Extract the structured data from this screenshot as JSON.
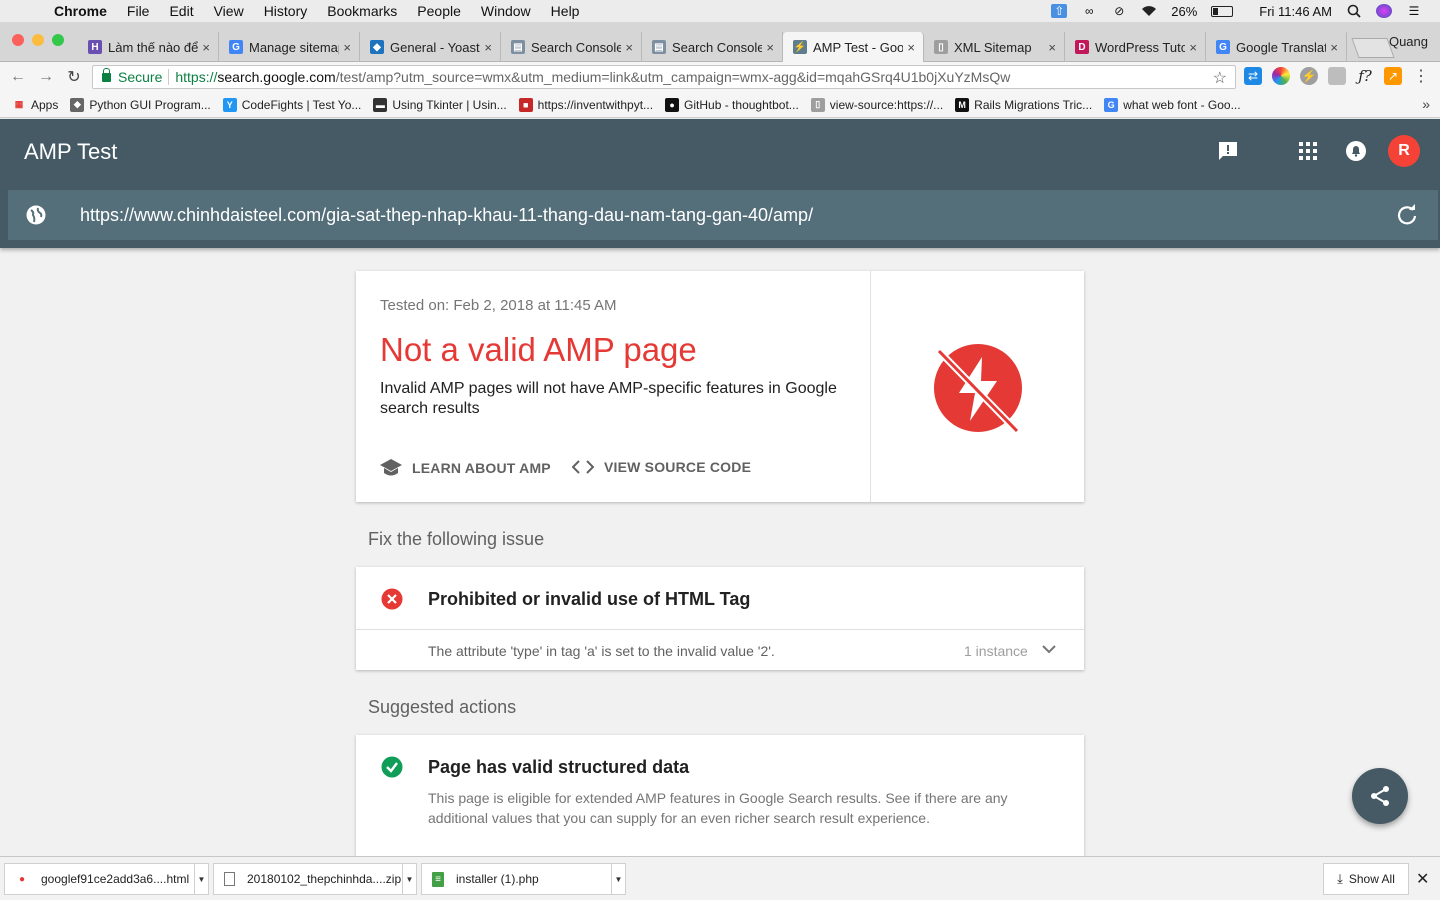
{
  "menubar": {
    "app": "Chrome",
    "items": [
      "File",
      "Edit",
      "View",
      "History",
      "Bookmarks",
      "People",
      "Window",
      "Help"
    ],
    "battery": "26%",
    "clock": "Fri 11:46 AM"
  },
  "tabs": [
    {
      "title": "Làm thế nào để",
      "fav_color": "#6a4fb3",
      "fav": "H"
    },
    {
      "title": "Manage sitemap",
      "fav_color": "#4285f4",
      "fav": "G"
    },
    {
      "title": "General - Yoast",
      "fav_color": "#1e73be",
      "fav": "◆"
    },
    {
      "title": "Search Console",
      "fav_color": "#7d8fa0",
      "fav": "▤"
    },
    {
      "title": "Search Console",
      "fav_color": "#7d8fa0",
      "fav": "▤"
    },
    {
      "title": "AMP Test - Goo",
      "fav_color": "#5f7d8c",
      "fav": "⚡"
    },
    {
      "title": "XML Sitemap",
      "fav_color": "#9e9e9e",
      "fav": "▯"
    },
    {
      "title": "WordPress Tuto",
      "fav_color": "#c2185b",
      "fav": "D"
    },
    {
      "title": "Google Translat",
      "fav_color": "#4285f4",
      "fav": "G"
    }
  ],
  "profile_name": "Quang",
  "omnibox": {
    "secure_label": "Secure",
    "url_scheme": "https://",
    "url_host": "search.google.com",
    "url_rest": "/test/amp?utm_source=wmx&utm_medium=link&utm_campaign=wmx-agg&id=mqahGSrq4U1b0jXuYzMsQw"
  },
  "bookmarks": [
    {
      "label": "Apps",
      "color": "#e53935",
      "icon": "▦"
    },
    {
      "label": "Python GUI Program...",
      "color": "#666666",
      "icon": "◆"
    },
    {
      "label": "CodeFights | Test Yo...",
      "color": "#2196f3",
      "icon": "Y"
    },
    {
      "label": "Using Tkinter | Usin...",
      "color": "#333333",
      "icon": "▬"
    },
    {
      "label": "https://inventwithpyt...",
      "color": "#c62828",
      "icon": "■"
    },
    {
      "label": "GitHub - thoughtbot...",
      "color": "#111111",
      "icon": "●"
    },
    {
      "label": "view-source:https://...",
      "color": "#9e9e9e",
      "icon": "▯"
    },
    {
      "label": "Rails Migrations Tric...",
      "color": "#111111",
      "icon": "M"
    },
    {
      "label": "what web font - Goo...",
      "color": "#4285f4",
      "icon": "G"
    }
  ],
  "app": {
    "title": "AMP Test",
    "avatar_letter": "R",
    "tested_url": "https://www.chinhdaisteel.com/gia-sat-thep-nhap-khau-11-thang-dau-nam-tang-gan-40/amp/"
  },
  "result": {
    "tested_on": "Tested on: Feb 2, 2018 at 11:45 AM",
    "verdict": "Not a valid AMP page",
    "description": "Invalid AMP pages will not have AMP-specific features in Google search results",
    "learn_label": "LEARN ABOUT AMP",
    "source_label": "VIEW SOURCE CODE",
    "accent": "#e53935"
  },
  "issues": {
    "heading": "Fix the following issue",
    "title": "Prohibited or invalid use of HTML Tag",
    "detail": "The attribute 'type' in tag 'a' is set to the invalid value '2'.",
    "instances": "1 instance"
  },
  "suggestions": {
    "heading": "Suggested actions",
    "title": "Page has valid structured data",
    "description": "This page is eligible for extended AMP features in Google Search results. See if there are any additional values that you can supply for an even richer search result experience.",
    "ok_color": "#0f9d58"
  },
  "downloads": [
    {
      "name": "googlef91ce2add3a6....html",
      "icon_color": "#e53935"
    },
    {
      "name": "20180102_thepchinhda....zip",
      "icon_color": "#616161"
    },
    {
      "name": "installer (1).php",
      "icon_color": "#43a047"
    }
  ],
  "show_all_label": "Show All"
}
